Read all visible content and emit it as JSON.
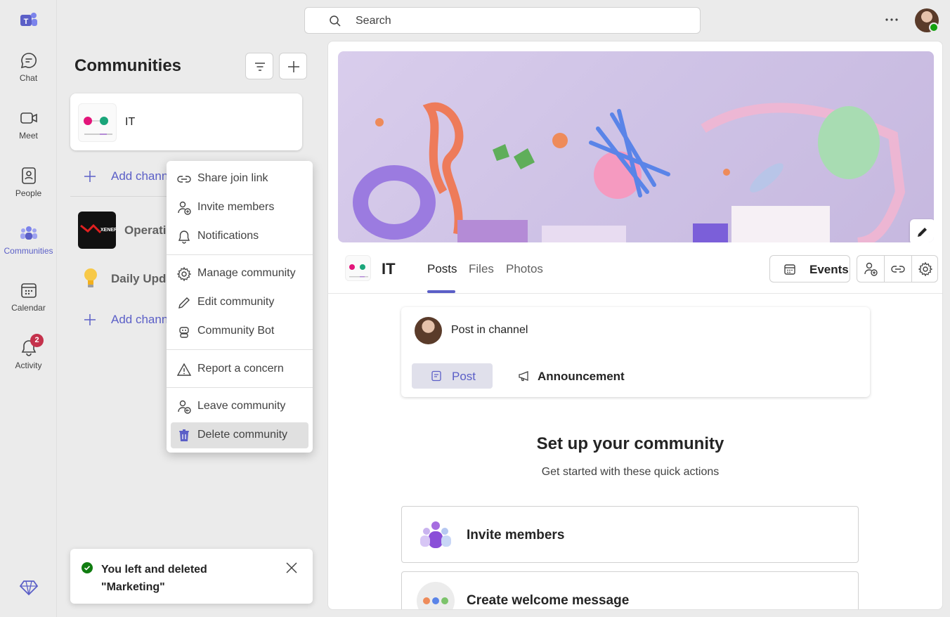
{
  "rail": {
    "items": [
      {
        "label": "Chat",
        "icon": "chat-icon"
      },
      {
        "label": "Meet",
        "icon": "video-camera-icon"
      },
      {
        "label": "People",
        "icon": "contact-card-icon"
      },
      {
        "label": "Communities",
        "icon": "communities-icon"
      },
      {
        "label": "Calendar",
        "icon": "calendar-icon"
      },
      {
        "label": "Activity",
        "icon": "bell-icon",
        "badge": "2"
      }
    ],
    "active": "Communities",
    "accent": "#5b5fc7"
  },
  "search": {
    "placeholder": "Search"
  },
  "panel": {
    "title": "Communities",
    "communities": [
      {
        "name": "IT"
      },
      {
        "add_label": "Add channel"
      },
      {
        "name": "Operations"
      },
      {
        "name": "Daily Updates"
      },
      {
        "add_label": "Add channel"
      }
    ],
    "first_add_label": "Add chann",
    "operations_label": "Operatio",
    "daily_label": "Daily Upda",
    "second_add_label": "Add chann"
  },
  "menu": {
    "items": [
      {
        "label": "Share join link",
        "icon": "link-icon"
      },
      {
        "label": "Invite members",
        "icon": "person-add-icon"
      },
      {
        "label": "Notifications",
        "icon": "bell-icon"
      },
      {
        "label": "Manage community",
        "icon": "gear-icon"
      },
      {
        "label": "Edit community",
        "icon": "pencil-icon"
      },
      {
        "label": "Community Bot",
        "icon": "bot-icon"
      },
      {
        "label": "Report a concern",
        "icon": "warning-icon"
      },
      {
        "label": "Leave community",
        "icon": "person-leave-icon"
      },
      {
        "label": "Delete community",
        "icon": "trash-icon"
      }
    ],
    "hovered": "Delete community"
  },
  "toast": {
    "message_line1": "You left and deleted",
    "message_line2": "\"Marketing\""
  },
  "main": {
    "community_name": "IT",
    "tabs": [
      "Posts",
      "Files",
      "Photos"
    ],
    "active_tab": "Posts",
    "events_label": "Events",
    "post_prompt": "Post in channel",
    "post_label": "Post",
    "announcement_label": "Announcement",
    "setup_title": "Set up your community",
    "setup_subtitle": "Get started with these quick actions",
    "actions": [
      "Invite members",
      "Create welcome message"
    ]
  }
}
